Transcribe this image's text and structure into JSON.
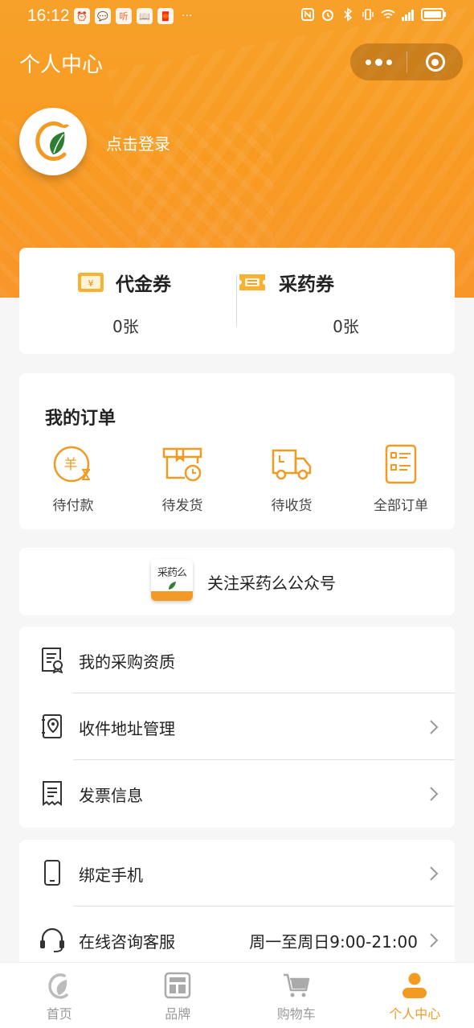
{
  "status_bar": {
    "time": "16:12",
    "app_icons": [
      "alarm-app-icon",
      "chat-app-icon",
      "listen-app-icon",
      "book-app-icon",
      "redpacket-app-icon"
    ],
    "listen_label": "听",
    "more": "···"
  },
  "header": {
    "title": "个人中心",
    "login_text": "点击登录"
  },
  "coupons": [
    {
      "label": "代金券",
      "count": "0张",
      "icon": "voucher-icon"
    },
    {
      "label": "采药券",
      "count": "0张",
      "icon": "ticket-icon"
    }
  ],
  "orders": {
    "title": "我的订单",
    "items": [
      {
        "label": "待付款",
        "icon": "pending-payment-icon"
      },
      {
        "label": "待发货",
        "icon": "pending-shipment-icon"
      },
      {
        "label": "待收货",
        "icon": "delivery-truck-icon"
      },
      {
        "label": "全部订单",
        "icon": "all-orders-icon"
      }
    ]
  },
  "follow": {
    "logo_text": "采药么",
    "text": "关注采药么公众号"
  },
  "menu_group_1": [
    {
      "label": "我的采购资质",
      "icon": "certificate-icon"
    },
    {
      "label": "收件地址管理",
      "icon": "address-book-icon"
    },
    {
      "label": "发票信息",
      "icon": "invoice-icon"
    }
  ],
  "menu_group_2": [
    {
      "label": "绑定手机",
      "icon": "phone-icon"
    },
    {
      "label": "在线咨询客服",
      "icon": "headset-icon",
      "value": "周一至周日9:00-21:00"
    }
  ],
  "tabbar": [
    {
      "label": "首页",
      "icon": "home-icon",
      "active": false
    },
    {
      "label": "品牌",
      "icon": "brand-icon",
      "active": false
    },
    {
      "label": "购物车",
      "icon": "cart-icon",
      "active": false
    },
    {
      "label": "个人中心",
      "icon": "profile-icon",
      "active": true
    }
  ],
  "colors": {
    "accent": "#f39a23",
    "header_bg": "#f7a12a",
    "page_bg": "#f6f6f6"
  }
}
